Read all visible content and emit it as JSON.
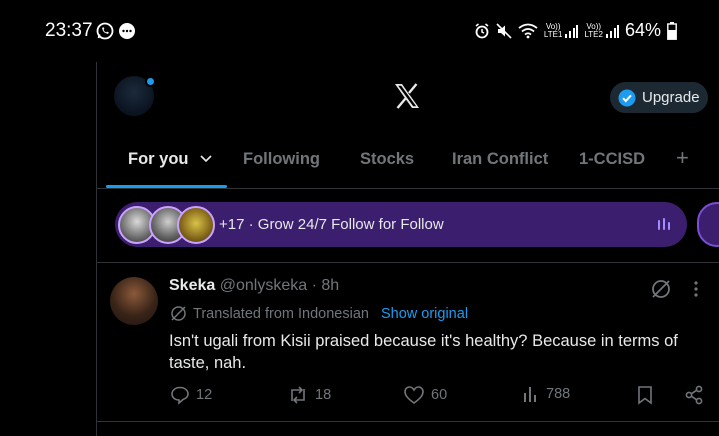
{
  "status_bar": {
    "time": "23:37",
    "sim1_label": "Vo))",
    "sim1_sub": "LTE1",
    "sim2_label": "Vo))",
    "sim2_sub": "LTE2",
    "battery": "64%"
  },
  "header": {
    "upgrade_label": "Upgrade"
  },
  "tabs": [
    {
      "label": "For you",
      "active": true
    },
    {
      "label": "Following",
      "active": false
    },
    {
      "label": "Stocks",
      "active": false
    },
    {
      "label": "Iran Conflict",
      "active": false
    },
    {
      "label": "1-CCISD",
      "active": false
    }
  ],
  "banner": {
    "text": "+17 · Grow 24/7 Follow for Follow"
  },
  "post": {
    "name": "Skeka",
    "handle": "@onlyskeka",
    "time": "· 8h",
    "translated_label": "Translated from Indonesian",
    "show_original_label": "Show original",
    "body": "Isn't ugali from Kisii praised because it's healthy? Because in terms of taste, nah.",
    "replies": "12",
    "reposts": "18",
    "likes": "60",
    "views": "788"
  },
  "colors": {
    "accent": "#1d9bf0",
    "banner_bg": "#3b1e6e",
    "muted": "#71767b"
  }
}
